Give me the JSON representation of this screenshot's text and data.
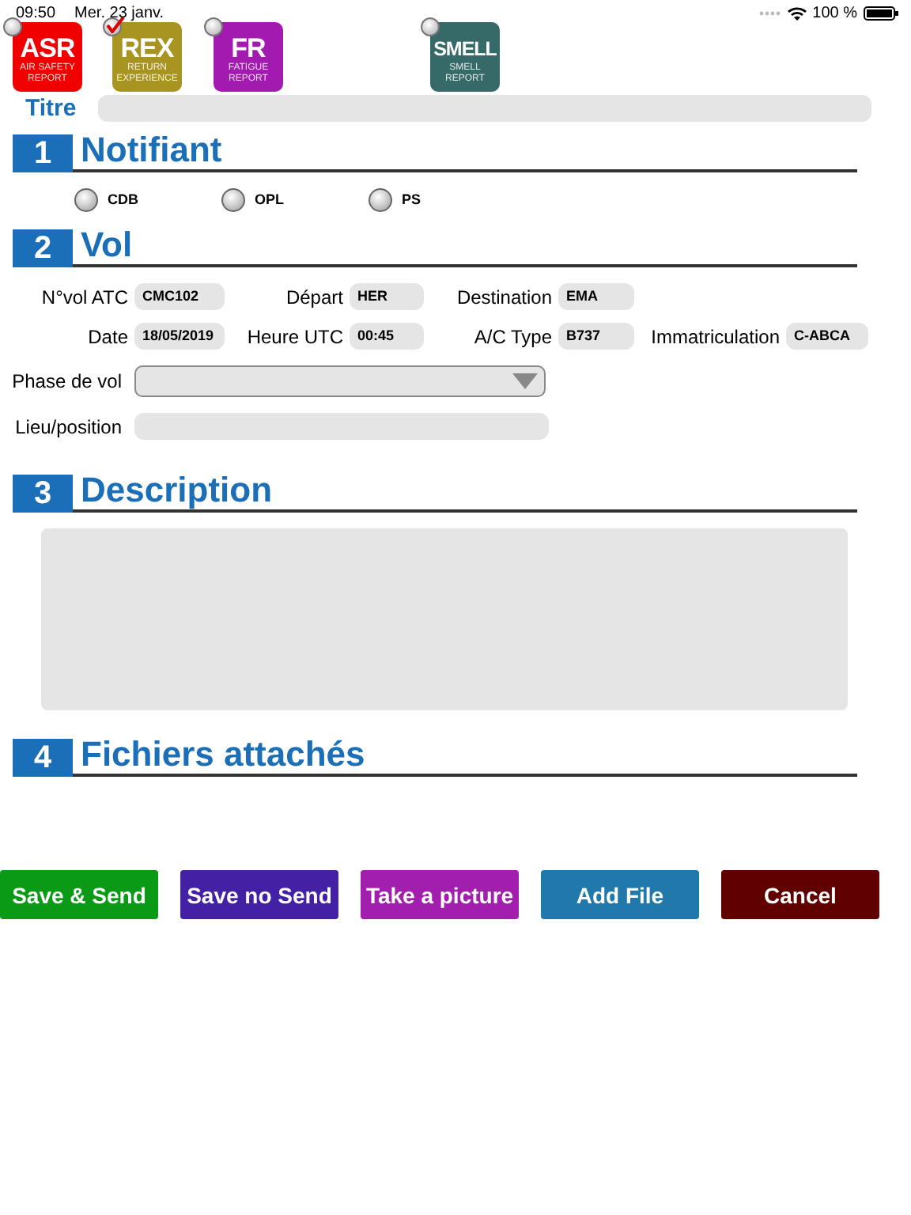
{
  "status_bar": {
    "time": "09:50",
    "date": "Mer. 23 janv.",
    "battery": "100 %"
  },
  "report_types": [
    {
      "kind": "asr",
      "code": "ASR",
      "caption": "AIR SAFETY REPORT",
      "color": "#f00000",
      "selected": false
    },
    {
      "kind": "rex",
      "code": "REX",
      "caption": "RETURN EXPERIENCE",
      "color": "#a89420",
      "selected": true
    },
    {
      "kind": "fr",
      "code": "FR",
      "caption": "FATIGUE REPORT",
      "color": "#a21ab0",
      "selected": false
    },
    {
      "kind": "smell",
      "code": "SMELL",
      "caption": "SMELL REPORT",
      "color": "#356a68",
      "selected": false
    }
  ],
  "title_field": {
    "label": "Titre"
  },
  "sections": [
    {
      "number": "1",
      "title": "Notifiant"
    },
    {
      "number": "2",
      "title": "Vol"
    },
    {
      "number": "3",
      "title": "Description"
    },
    {
      "number": "4",
      "title": "Fichiers attachés"
    }
  ],
  "notifiant": [
    {
      "label": "CDB",
      "selected": false
    },
    {
      "label": "OPL",
      "selected": false
    },
    {
      "label": "PS",
      "selected": false
    }
  ],
  "flight_fields": [
    {
      "label": "N°vol ATC",
      "value": "CMC102"
    },
    {
      "label": "Départ",
      "value": "HER"
    },
    {
      "label": "Destination",
      "value": "EMA"
    },
    {
      "label": "Date",
      "value": "18/05/2019"
    },
    {
      "label": "Heure UTC",
      "value": "00:45"
    },
    {
      "label": "A/C Type",
      "value": "B737"
    },
    {
      "label": "Immatriculation",
      "value": "C-ABCA"
    }
  ],
  "phase": {
    "label": "Phase de  vol"
  },
  "position": {
    "label": "Lieu/position"
  },
  "buttons": [
    {
      "label": "Save & Send",
      "color": "#0a9a16"
    },
    {
      "label": "Save no Send",
      "color": "#4320a4"
    },
    {
      "label": "Take a picture",
      "color": "#a21eac"
    },
    {
      "label": "Add File",
      "color": "#2079aa"
    },
    {
      "label": "Cancel",
      "color": "#600000"
    }
  ]
}
